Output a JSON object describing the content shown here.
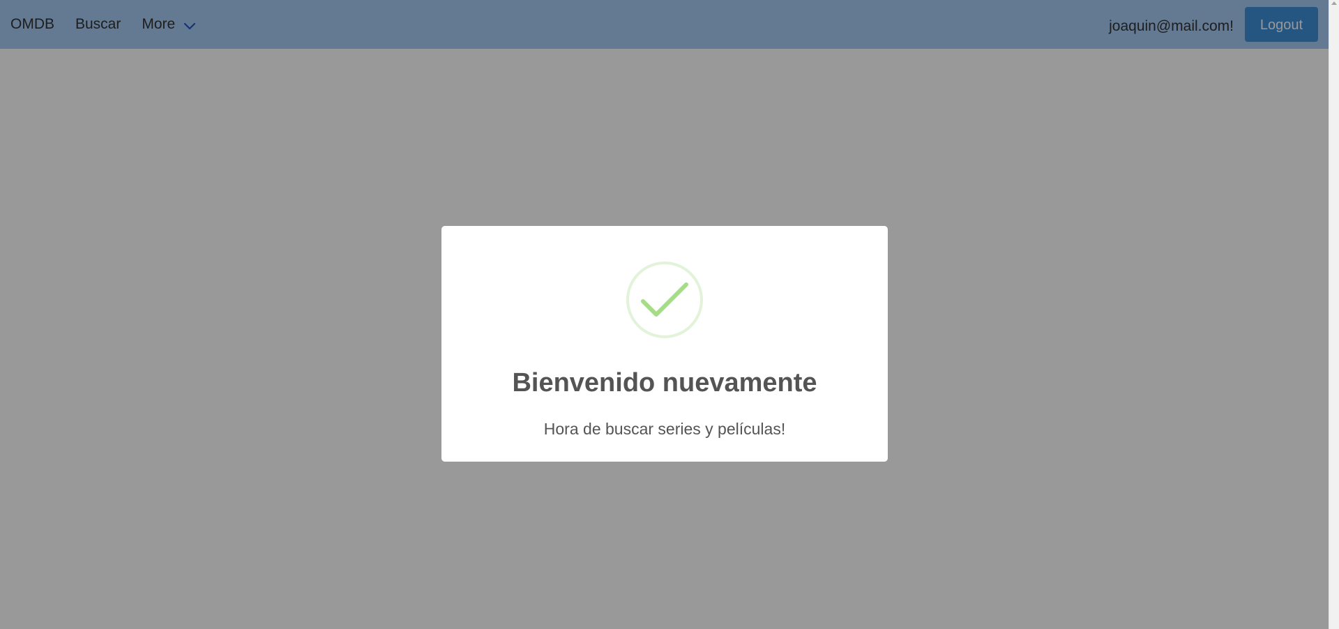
{
  "navbar": {
    "brand": "OMDB",
    "links": [
      {
        "label": "Buscar"
      },
      {
        "label": "More"
      }
    ],
    "user_email": "joaquin@mail.com!",
    "logout_label": "Logout"
  },
  "modal": {
    "icon": "success-check-icon",
    "title": "Bienvenido nuevamente",
    "text": "Hora de buscar series y películas!"
  },
  "colors": {
    "navbar_bg": "#a5cbf3",
    "logout_bg": "#3e8ed8",
    "success_green": "#a5dc86",
    "overlay": "rgba(0,0,0,0.4)"
  }
}
